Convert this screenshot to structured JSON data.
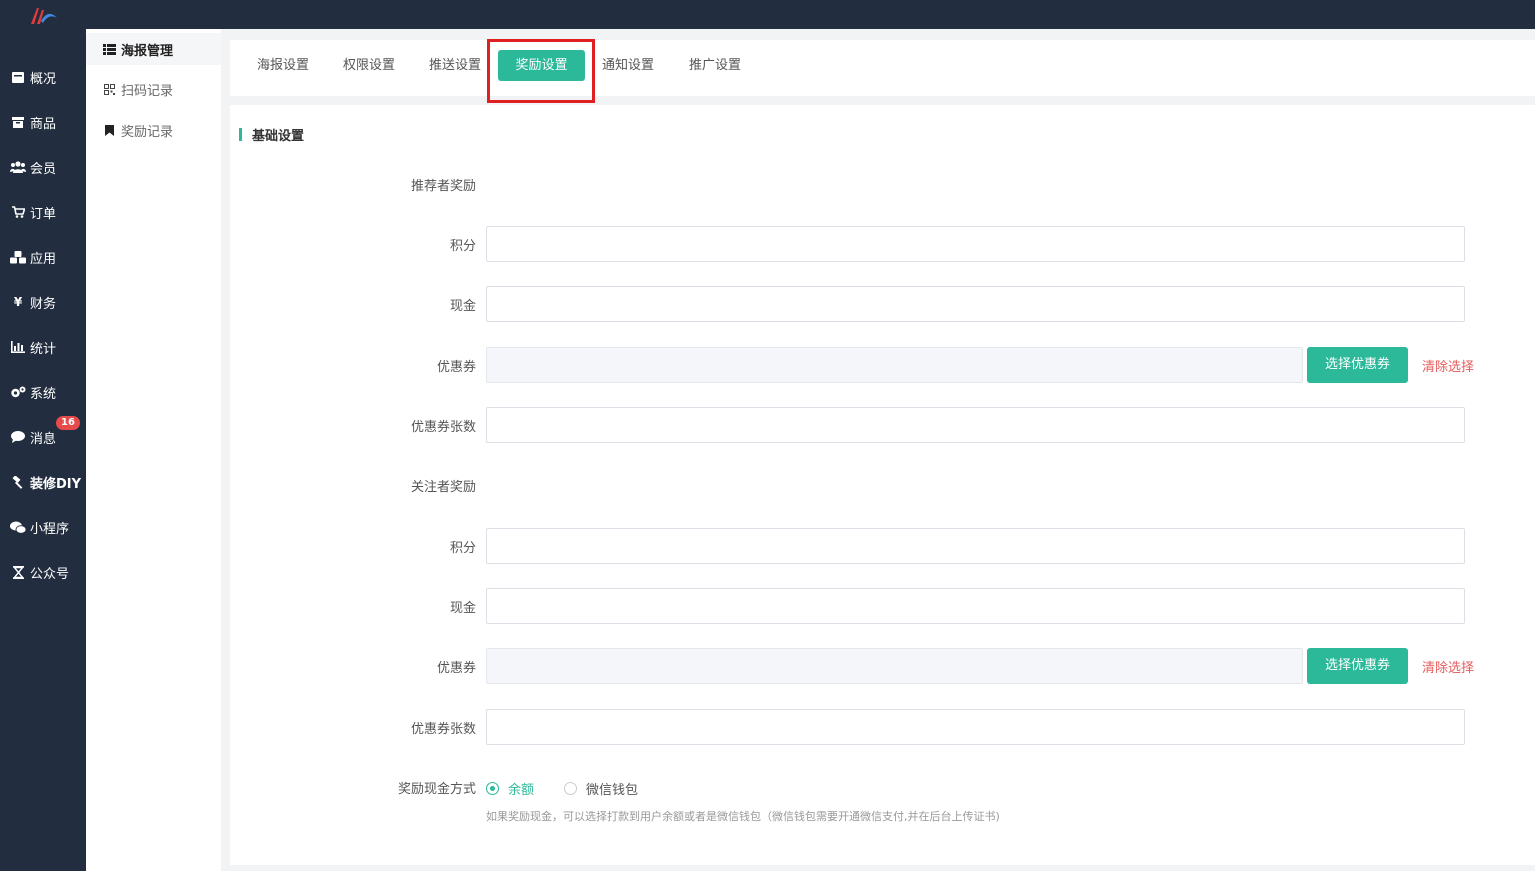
{
  "nav": {
    "items": [
      {
        "id": "overview",
        "label": "概况",
        "icon": "dashboard-icon"
      },
      {
        "id": "goods",
        "label": "商品",
        "icon": "box-icon"
      },
      {
        "id": "member",
        "label": "会员",
        "icon": "users-icon"
      },
      {
        "id": "order",
        "label": "订单",
        "icon": "cart-icon"
      },
      {
        "id": "app",
        "label": "应用",
        "icon": "cubes-icon"
      },
      {
        "id": "finance",
        "label": "财务",
        "icon": "yen-icon"
      },
      {
        "id": "stats",
        "label": "统计",
        "icon": "bar-chart-icon"
      },
      {
        "id": "system",
        "label": "系统",
        "icon": "gears-icon"
      },
      {
        "id": "message",
        "label": "消息",
        "icon": "chat-icon",
        "badge": "16"
      },
      {
        "id": "diy",
        "label": "装修DIY",
        "icon": "hammer-icon"
      },
      {
        "id": "miniapp",
        "label": "小程序",
        "icon": "wechat-icon"
      },
      {
        "id": "official",
        "label": "公众号",
        "icon": "hourglass-icon"
      }
    ]
  },
  "subnav": {
    "items": [
      {
        "label": "海报管理",
        "icon": "list-icon",
        "active": true
      },
      {
        "label": "扫码记录",
        "icon": "qrcode-icon",
        "active": false
      },
      {
        "label": "奖励记录",
        "icon": "bookmark-icon",
        "active": false
      }
    ]
  },
  "tabs": [
    "海报设置",
    "权限设置",
    "推送设置",
    "奖励设置",
    "通知设置",
    "推广设置"
  ],
  "active_tab": "奖励设置",
  "section_title": "基础设置",
  "referrer": {
    "group_label": "推荐者奖励",
    "points_label": "积分",
    "cash_label": "现金",
    "coupon_label": "优惠券",
    "coupon_count_label": "优惠券张数"
  },
  "follower": {
    "group_label": "关注者奖励",
    "points_label": "积分",
    "cash_label": "现金",
    "coupon_label": "优惠券",
    "coupon_count_label": "优惠券张数"
  },
  "buttons": {
    "select_coupon": "选择优惠券",
    "clear_selection": "清除选择"
  },
  "cash_method": {
    "label": "奖励现金方式",
    "options": [
      "余额",
      "微信钱包"
    ],
    "selected": "余额",
    "hint": "如果奖励现金，可以选择打款到用户余额或者是微信钱包（微信钱包需要开通微信支付,并在后台上传证书)"
  },
  "colors": {
    "accent": "#2bb99a",
    "sidebar": "#222d3f",
    "danger": "#e65b5b",
    "highlight": "#e02020"
  }
}
